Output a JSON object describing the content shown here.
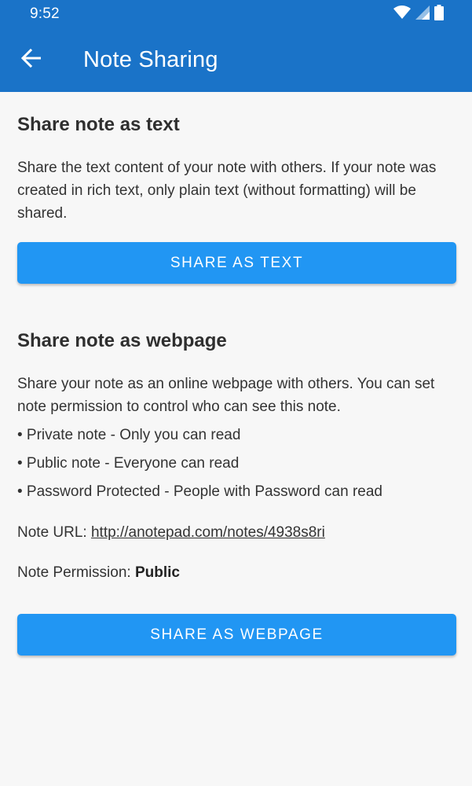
{
  "status_bar": {
    "time": "9:52",
    "icons": [
      "wifi-icon",
      "signal-icon",
      "battery-icon"
    ]
  },
  "app_bar": {
    "title": "Note Sharing",
    "back_icon": "arrow-back-icon",
    "color": "#1a73c8"
  },
  "share_text": {
    "heading": "Share note as text",
    "description": "Share the text content of your note with others. If your note was created in rich text, only plain text (without formatting) will be shared.",
    "button_label": "SHARE AS TEXT"
  },
  "share_webpage": {
    "heading": "Share note as webpage",
    "description": "Share your note as an online webpage with others. You can set note permission to control who can see this note.",
    "bullets": [
      "• Private note - Only you can read",
      "• Public note - Everyone can read",
      "• Password Protected - People with Password can read"
    ],
    "url_label": "Note URL: ",
    "url_value": "http://anotepad.com/notes/4938s8ri",
    "permission_label": "Note Permission: ",
    "permission_value": "Public",
    "button_label": "SHARE AS WEBPAGE"
  },
  "colors": {
    "accent_button": "#2196f3",
    "background": "#f7f7f7"
  }
}
